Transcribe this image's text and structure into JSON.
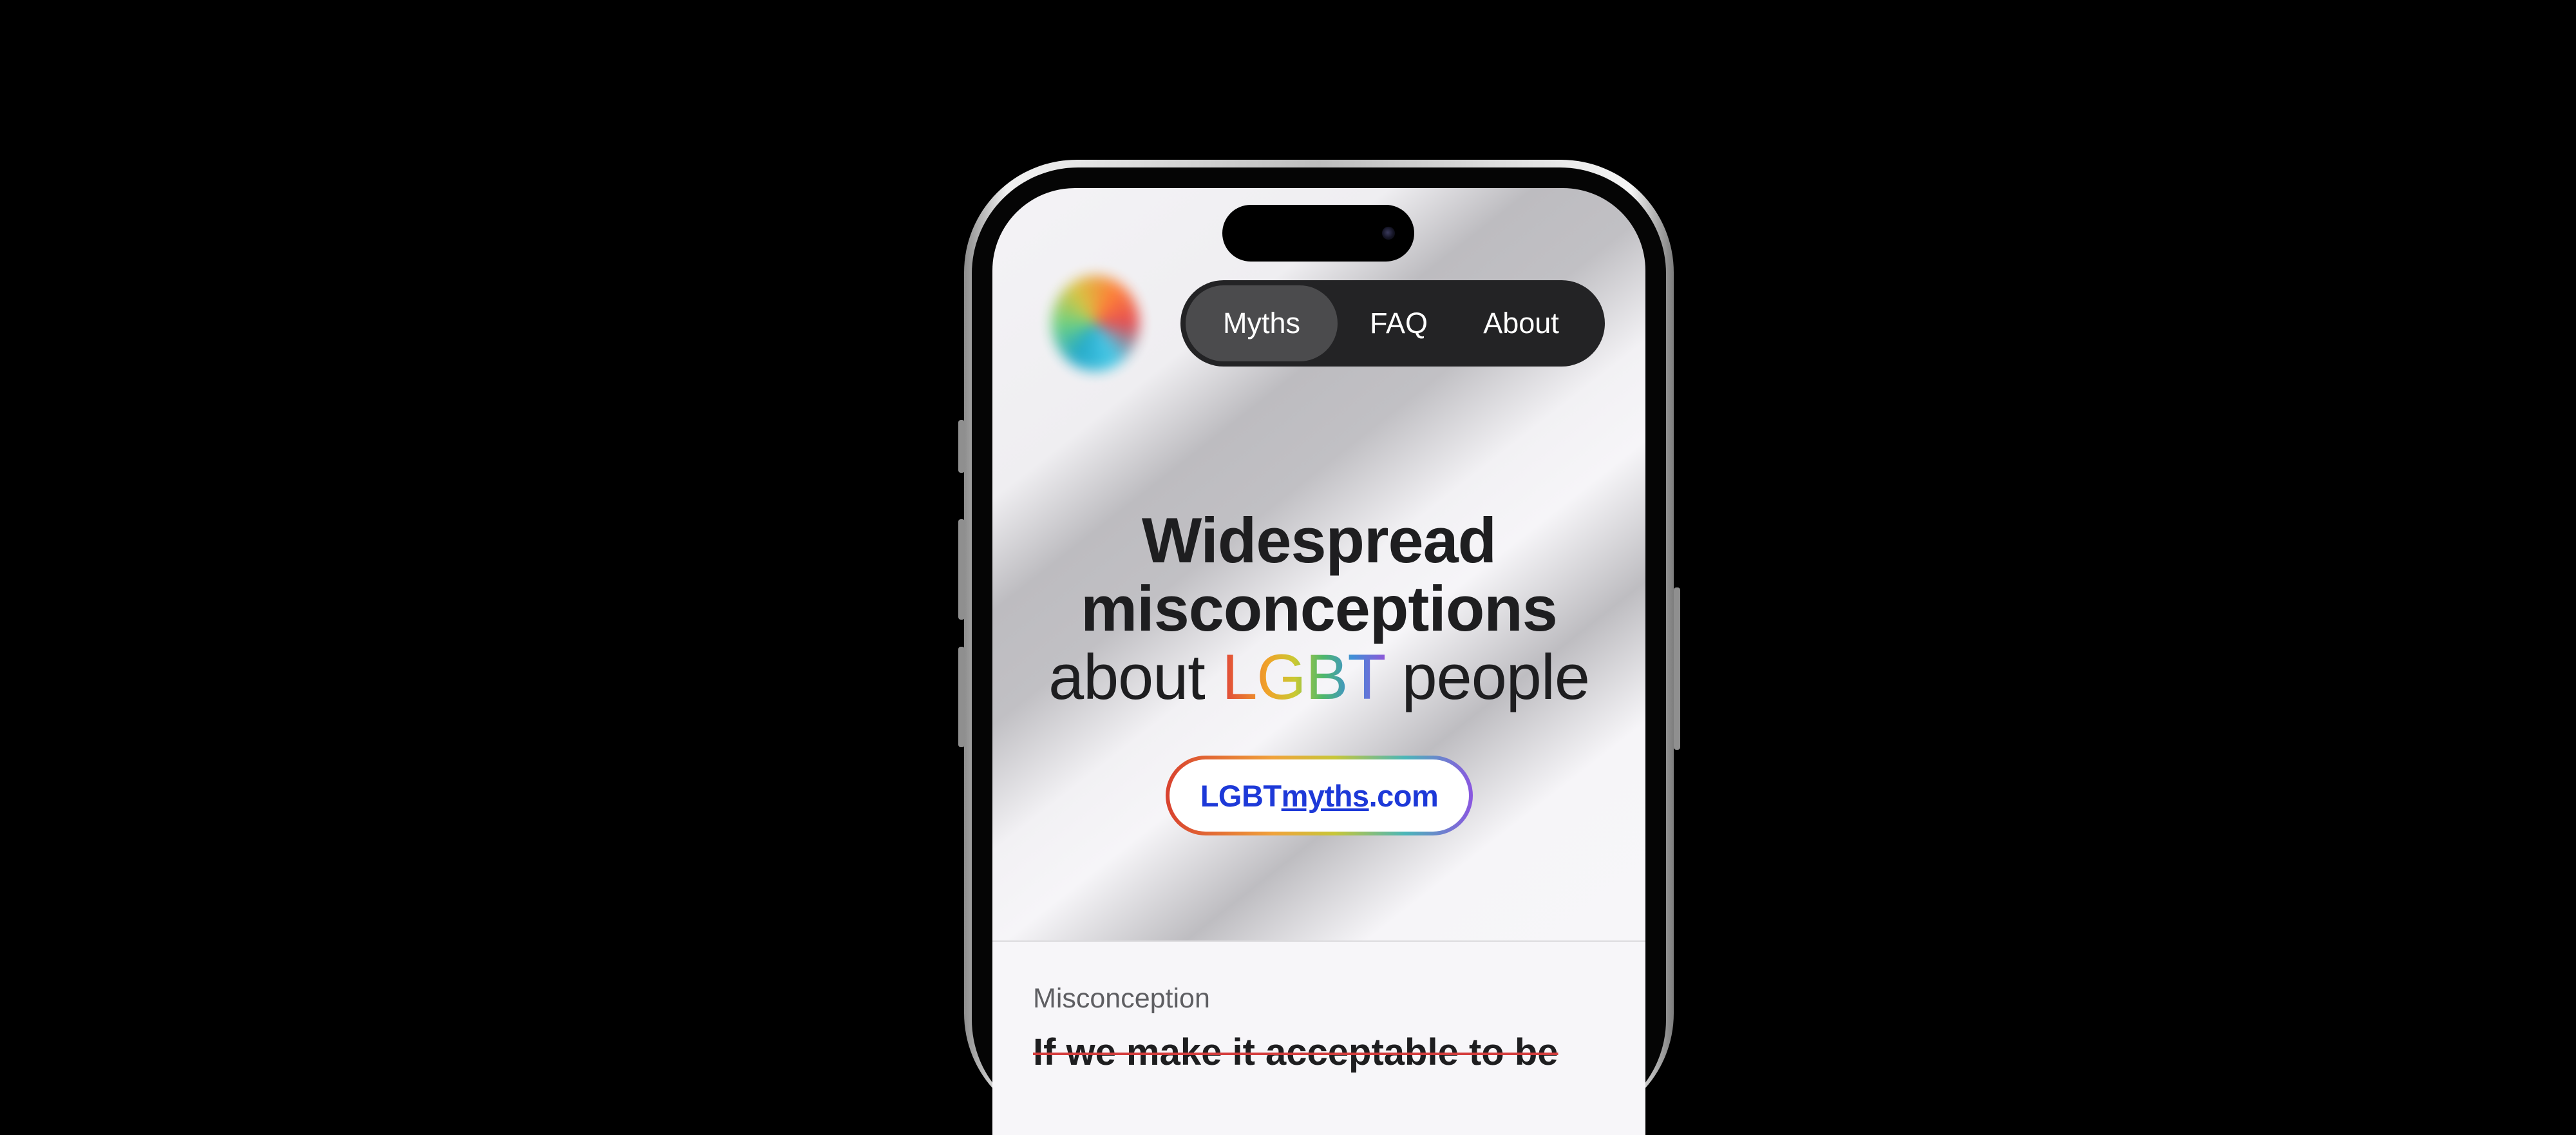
{
  "nav": {
    "items": [
      {
        "label": "Myths",
        "active": true
      },
      {
        "label": "FAQ",
        "active": false
      },
      {
        "label": "About",
        "active": false
      }
    ]
  },
  "hero": {
    "line1": "Widespread",
    "line2": "misconceptions",
    "line3_prefix": "about",
    "line3_highlight": "LGBT",
    "line3_suffix": "people"
  },
  "site_link": {
    "part1": "LGBT",
    "part2": "myths",
    "part3": ".com"
  },
  "card": {
    "label": "Misconception",
    "text": "If we make it acceptable to be"
  },
  "colors": {
    "nav_bg": "#232325",
    "nav_active": "#4b4b4d",
    "link": "#1d39d8",
    "heading": "#1e1e20",
    "strike": "#d43c3c"
  }
}
